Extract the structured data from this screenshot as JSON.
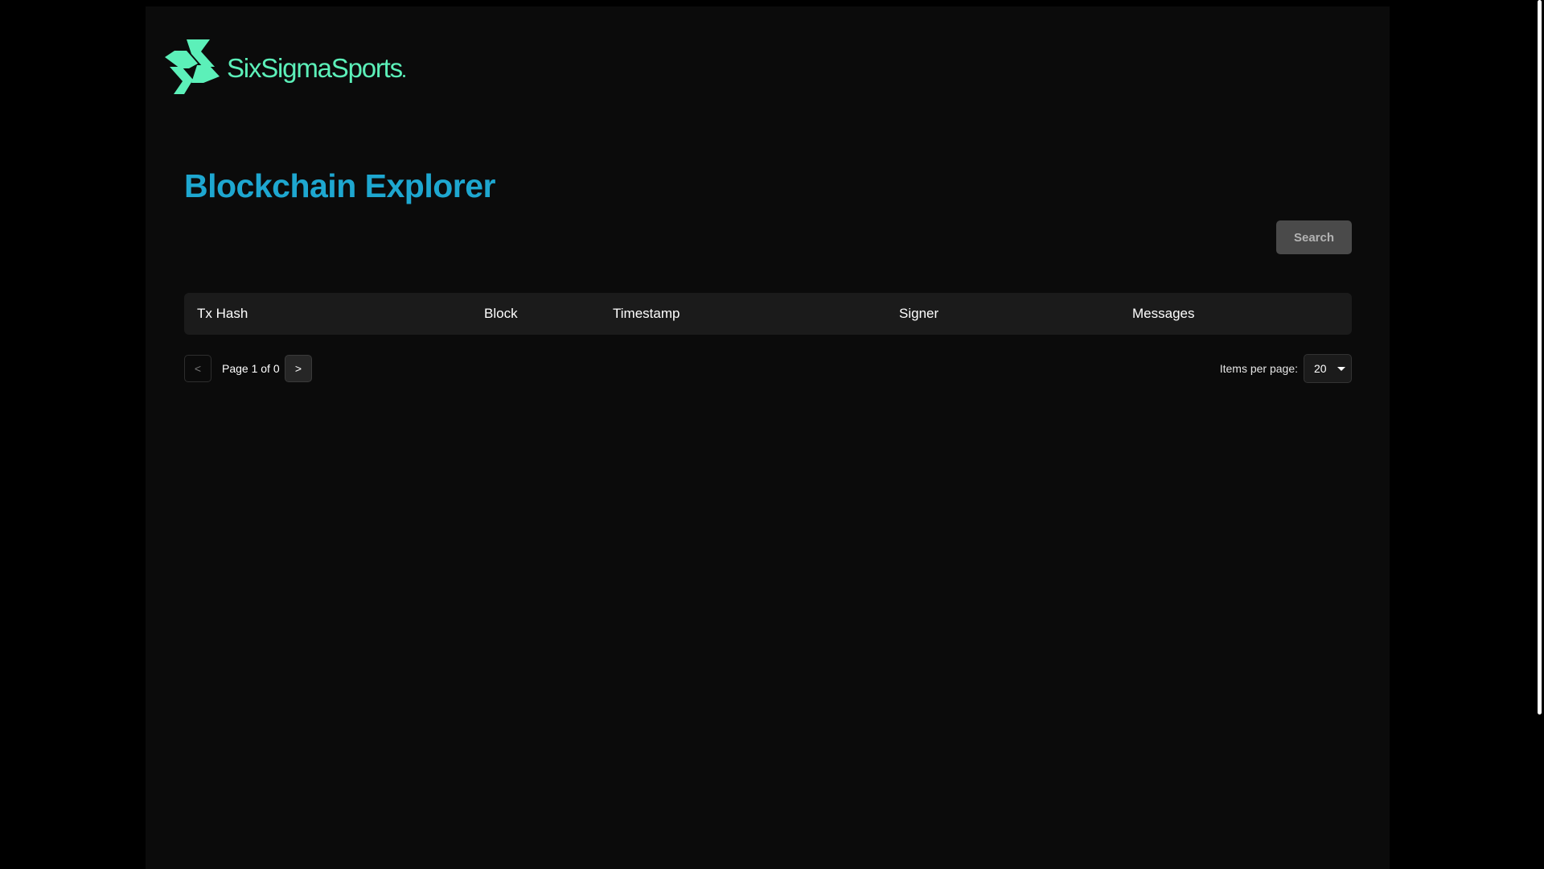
{
  "brand": {
    "name": "SixSigmaSports",
    "color": "#5cf0b9"
  },
  "page": {
    "title": "Blockchain Explorer",
    "title_color": "#1ea7d0"
  },
  "search": {
    "button_label": "Search"
  },
  "table": {
    "columns": [
      "Tx Hash",
      "Block",
      "Timestamp",
      "Signer",
      "Messages"
    ],
    "rows": []
  },
  "pagination": {
    "prev_label": "<",
    "next_label": ">",
    "page_text": "Page 1 of 0",
    "items_per_page_label": "Items per page:",
    "items_per_page_value": "20"
  },
  "icons": {
    "logo": "sixsigmasports-logo-icon",
    "select_caret": "caret-down-icon"
  }
}
